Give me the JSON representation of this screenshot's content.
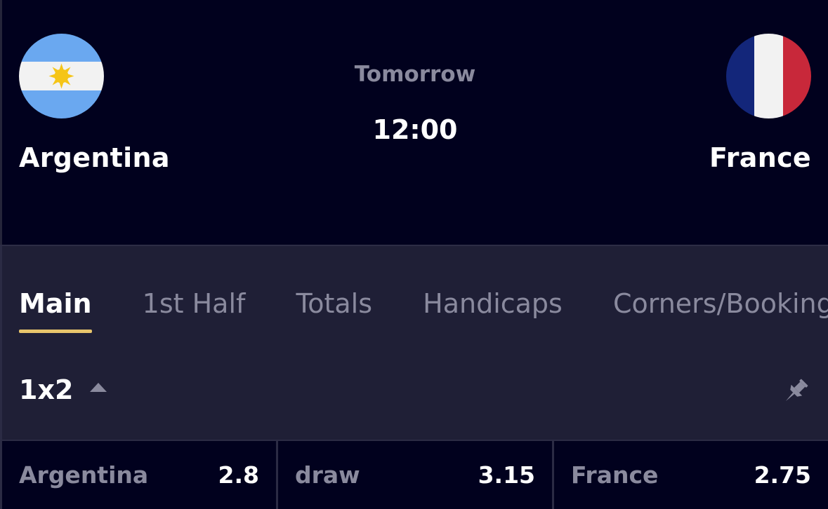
{
  "match": {
    "home": {
      "name": "Argentina",
      "flag": "argentina-flag"
    },
    "away": {
      "name": "France",
      "flag": "france-flag"
    },
    "day": "Tomorrow",
    "time": "12:00"
  },
  "tabs": [
    {
      "label": "Main",
      "active": true
    },
    {
      "label": "1st Half",
      "active": false
    },
    {
      "label": "Totals",
      "active": false
    },
    {
      "label": "Handicaps",
      "active": false
    },
    {
      "label": "Corners/Bookings",
      "active": false
    }
  ],
  "market": {
    "title": "1x2",
    "collapse_icon": "caret-up-icon",
    "pin_icon": "pin-icon"
  },
  "odds": [
    {
      "label": "Argentina",
      "value": "2.8"
    },
    {
      "label": "draw",
      "value": "3.15"
    },
    {
      "label": "France",
      "value": "2.75"
    }
  ],
  "colors": {
    "background": "#01011e",
    "panel": "#1f1f36",
    "muted_text": "#8a8a9e",
    "accent_underline": "#e7c46b"
  }
}
